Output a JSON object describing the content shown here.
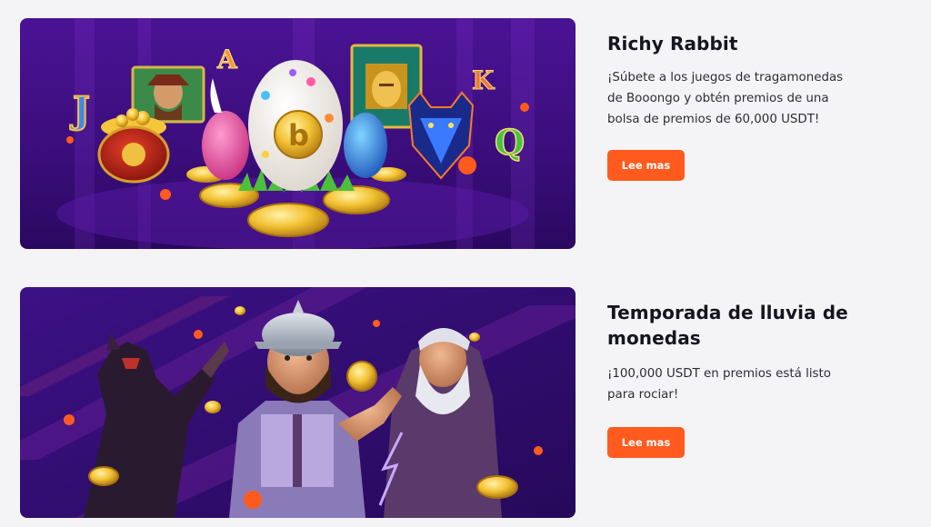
{
  "colors": {
    "page_background": "#f4f4f6",
    "accent_button": "#ff5b1f",
    "banner_purple": "#3b0f7a"
  },
  "promos": [
    {
      "title": "Richy Rabbit",
      "description": "¡Súbete a los juegos de tragamonedas de Booongo y obtén premios de una bolsa de premios de 60,000 USDT!",
      "button_label": "Lee mas",
      "banner_letters": [
        "J",
        "A",
        "K",
        "Q"
      ],
      "banner_egg_glyph": "b"
    },
    {
      "title": "Temporada de lluvia de monedas",
      "description": "¡100,000 USDT en premios está listo para rociar!",
      "button_label": "Lee mas"
    }
  ]
}
